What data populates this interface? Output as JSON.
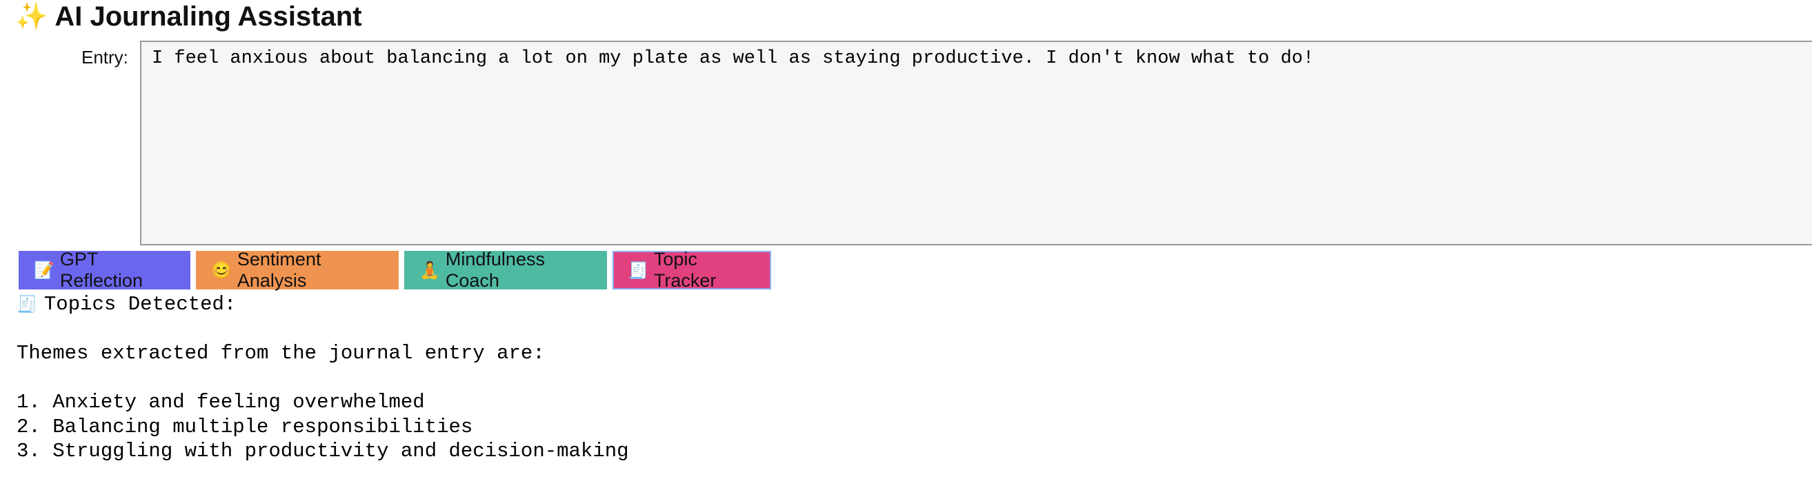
{
  "app": {
    "title": "AI Journaling Assistant",
    "title_icon": "sparkles-icon"
  },
  "entry": {
    "label": "Entry:",
    "value": "I feel anxious about balancing a lot on my plate as well as staying productive. I don't know what to do!"
  },
  "buttons": [
    {
      "label": "GPT Reflection",
      "icon": "memo-icon",
      "color": "#6b66ee"
    },
    {
      "label": "Sentiment Analysis",
      "icon": "smiley-icon",
      "color": "#ef9450"
    },
    {
      "label": "Mindfulness Coach",
      "icon": "meditation-icon",
      "color": "#4fbaa2"
    },
    {
      "label": "Topic Tracker",
      "icon": "receipt-icon",
      "color": "#e2417f",
      "active": true
    }
  ],
  "output": {
    "heading": "Topics Detected:",
    "intro": "Themes extracted from the journal entry are:",
    "items": [
      "1. Anxiety and feeling overwhelmed",
      "2. Balancing multiple responsibilities",
      "3. Struggling with productivity and decision-making"
    ]
  }
}
